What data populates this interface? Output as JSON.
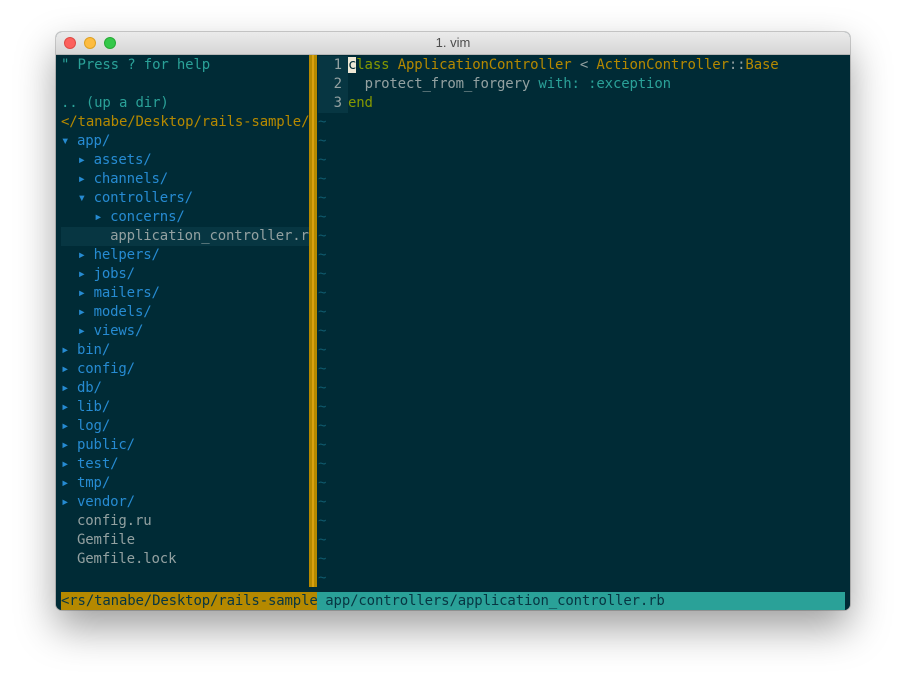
{
  "window": {
    "title": "1. vim"
  },
  "tree": {
    "help": "\" Press ? for help",
    "up_dir": ".. (up a dir)",
    "root": "</tanabe/Desktop/rails-sample/",
    "entries": [
      {
        "arrow": "▾",
        "name": "app/",
        "type": "dir"
      },
      {
        "arrow": "▸",
        "name": "assets/",
        "type": "dir"
      },
      {
        "arrow": "▸",
        "name": "channels/",
        "type": "dir"
      },
      {
        "arrow": "▾",
        "name": "controllers/",
        "type": "dir"
      },
      {
        "arrow": "▸",
        "name": "concerns/",
        "type": "dir"
      },
      {
        "arrow": "",
        "name": "application_controller.rb",
        "type": "file"
      },
      {
        "arrow": "▸",
        "name": "helpers/",
        "type": "dir"
      },
      {
        "arrow": "▸",
        "name": "jobs/",
        "type": "dir"
      },
      {
        "arrow": "▸",
        "name": "mailers/",
        "type": "dir"
      },
      {
        "arrow": "▸",
        "name": "models/",
        "type": "dir"
      },
      {
        "arrow": "▸",
        "name": "views/",
        "type": "dir"
      },
      {
        "arrow": "▸",
        "name": "bin/",
        "type": "dir"
      },
      {
        "arrow": "▸",
        "name": "config/",
        "type": "dir"
      },
      {
        "arrow": "▸",
        "name": "db/",
        "type": "dir"
      },
      {
        "arrow": "▸",
        "name": "lib/",
        "type": "dir"
      },
      {
        "arrow": "▸",
        "name": "log/",
        "type": "dir"
      },
      {
        "arrow": "▸",
        "name": "public/",
        "type": "dir"
      },
      {
        "arrow": "▸",
        "name": "test/",
        "type": "dir"
      },
      {
        "arrow": "▸",
        "name": "tmp/",
        "type": "dir"
      },
      {
        "arrow": "▸",
        "name": "vendor/",
        "type": "dir"
      },
      {
        "arrow": "",
        "name": "config.ru",
        "type": "file"
      },
      {
        "arrow": "",
        "name": "Gemfile",
        "type": "file"
      },
      {
        "arrow": "",
        "name": "Gemfile.lock",
        "type": "file"
      }
    ]
  },
  "editor": {
    "tilde": "~",
    "lines": [
      {
        "num": "1",
        "cursor_char": "c",
        "kw": "lass",
        "sp1": " ",
        "cls": "ApplicationController",
        "op": " < ",
        "parent_ns": "ActionController",
        "sep": "::",
        "parent": "Base"
      },
      {
        "num": "2",
        "indent": "  ",
        "method": "protect_from_forgery",
        "sp": " ",
        "key": "with:",
        "sp2": " ",
        "sym": ":exception"
      },
      {
        "num": "3",
        "kw": "end"
      }
    ]
  },
  "statusline": {
    "left": "<rs/tanabe/Desktop/rails-sample",
    "right": " app/controllers/application_controller.rb"
  }
}
